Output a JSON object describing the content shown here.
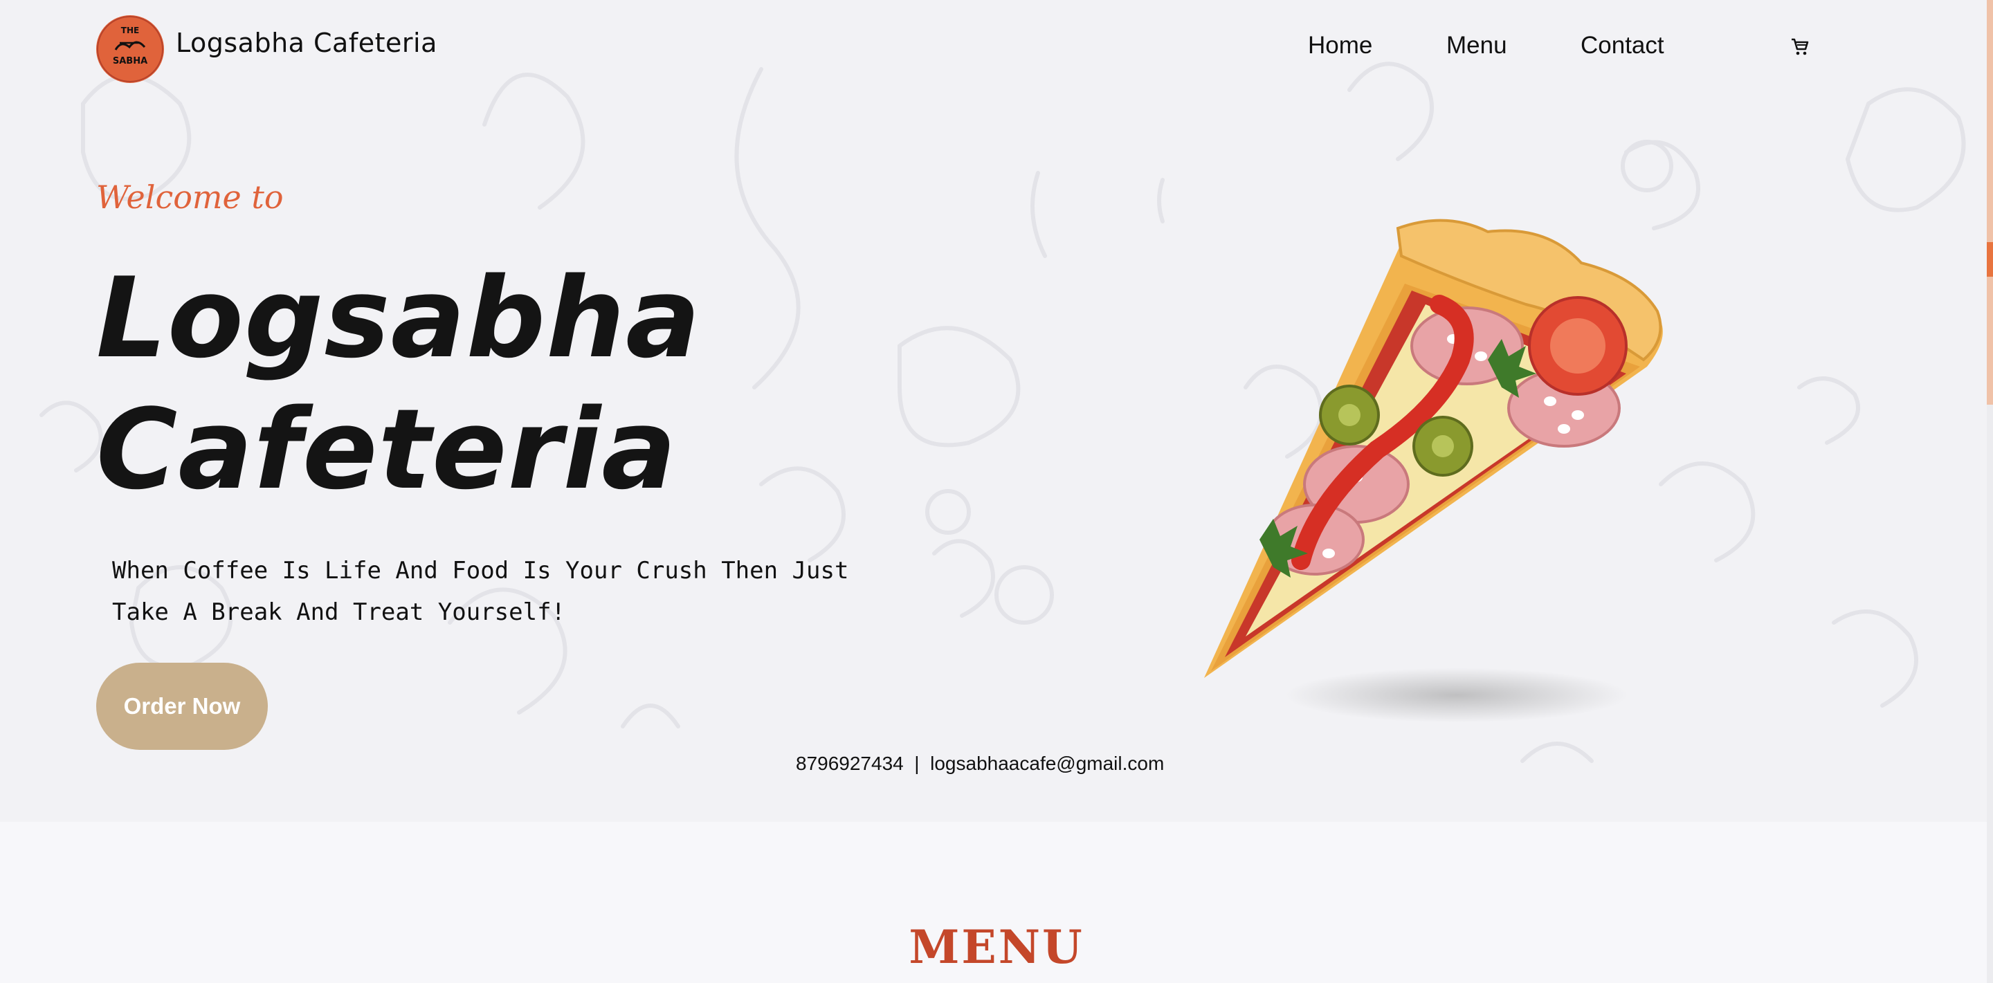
{
  "header": {
    "brand": "Logsabha Cafeteria",
    "nav": [
      "Home",
      "Menu",
      "Contact"
    ],
    "cart_icon": "cart-icon",
    "logo_text": [
      "THE",
      "SABHA"
    ]
  },
  "hero": {
    "welcome": "Welcome to",
    "title_line1": "Logsabha",
    "title_line2": "Cafeteria",
    "tagline": "When Coffee Is Life And Food Is Your Crush Then Just Take A Break And Treat Yourself!",
    "order_button": "Order Now",
    "phone": "8796927434",
    "separator": "|",
    "email": "logsabhaacafe@gmail.com",
    "image": "pizza-slice-illustration"
  },
  "menu_section": {
    "heading": "MENU"
  },
  "colors": {
    "accent": "#e0633b",
    "button": "#c9b08c",
    "menu_heading": "#c4472a",
    "background": "#f2f2f5"
  }
}
